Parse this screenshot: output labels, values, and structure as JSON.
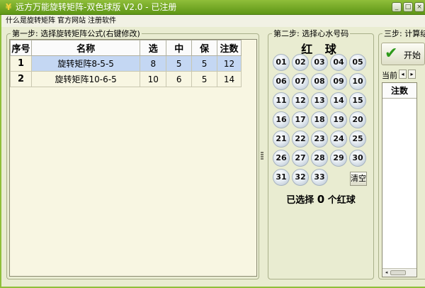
{
  "window": {
    "title": "远方万能旋转矩阵-双色球版 V2.0 - 已注册",
    "icon": "money-icon",
    "controls": {
      "minimize": "_",
      "maximize": "□",
      "close": "×"
    }
  },
  "menu": {
    "items": [
      "什么是旋转矩阵",
      "官方网站",
      "注册软件"
    ]
  },
  "step1": {
    "title": "第一步: 选择旋转矩阵公式(右键修改)",
    "columns": [
      "序号",
      "名称",
      "选",
      "中",
      "保",
      "注数"
    ],
    "rows": [
      {
        "idx": "1",
        "name": "旋转矩阵8-5-5",
        "pick": "8",
        "hit": "5",
        "guarantee": "5",
        "bets": "12",
        "selected": true
      },
      {
        "idx": "2",
        "name": "旋转矩阵10-6-5",
        "pick": "10",
        "hit": "6",
        "guarantee": "5",
        "bets": "14",
        "selected": false
      }
    ]
  },
  "step2": {
    "title": "第二步: 选择心水号码",
    "red_title": "红 球",
    "balls": [
      "01",
      "02",
      "03",
      "04",
      "05",
      "06",
      "07",
      "08",
      "09",
      "10",
      "11",
      "12",
      "13",
      "14",
      "15",
      "16",
      "17",
      "18",
      "19",
      "20",
      "21",
      "22",
      "23",
      "24",
      "25",
      "26",
      "27",
      "28",
      "29",
      "30",
      "31",
      "32",
      "33"
    ],
    "clear_label": "清空",
    "selected_prefix": "已选择",
    "selected_count": "0",
    "selected_suffix": "个红球"
  },
  "step3": {
    "title": "三步: 计算结",
    "start_label": "开始",
    "current_label": "当前",
    "list_header": "注数",
    "nav_prev": "◂",
    "nav_next": "▸"
  },
  "colors": {
    "titlebar": "#6fa324",
    "background": "#e9ecd1",
    "selected_row": "#c4d7f3"
  }
}
